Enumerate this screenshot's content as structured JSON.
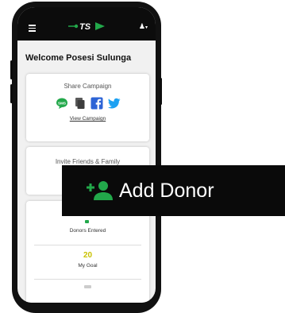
{
  "app": {
    "logo_text": "TS"
  },
  "header": {
    "welcome": "Welcome Posesi Sulunga"
  },
  "share_card": {
    "title": "Share Campaign",
    "sms_label": "SMS",
    "icons": [
      "sms-icon",
      "copy-icon",
      "facebook-icon",
      "twitter-icon"
    ],
    "view_link": "View Campaign"
  },
  "invite_card": {
    "title": "Invite Friends & Family"
  },
  "stats": {
    "donors_entered_label": "Donors Entered",
    "goal_value": "20",
    "goal_label": "My Goal"
  },
  "callout": {
    "label": "Add Donor",
    "icon": "add-person-icon"
  },
  "colors": {
    "accent_green": "#22a84a",
    "facebook_blue": "#2d64d6",
    "twitter_blue": "#1da1f2",
    "goal_yellow": "#c9c100",
    "topbar": "#0c0c0c"
  }
}
